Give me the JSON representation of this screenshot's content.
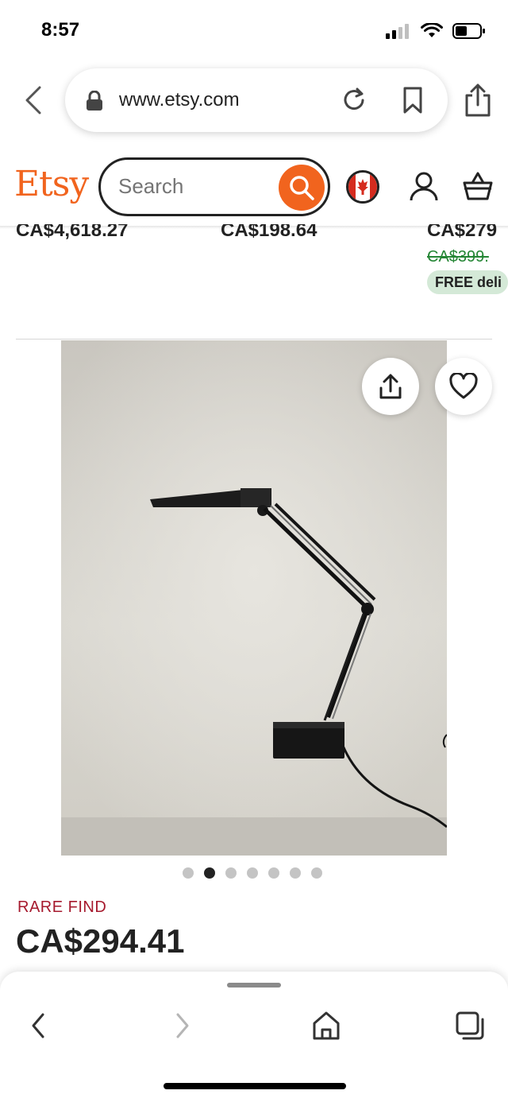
{
  "status_bar": {
    "time": "8:57",
    "icons": [
      "signal-icon",
      "wifi-icon",
      "battery-icon"
    ]
  },
  "browser": {
    "url": "www.etsy.com",
    "icons": [
      "back-arrow-icon",
      "lock-icon",
      "reload-icon",
      "bookmark-icon",
      "share-icon"
    ]
  },
  "header": {
    "logo": "Etsy",
    "search_placeholder": "Search",
    "icons": [
      "search-icon",
      "canada-flag-icon",
      "profile-icon",
      "cart-icon"
    ]
  },
  "prev_listings": {
    "prices": [
      "CA$4,618.27",
      "CA$198.64",
      "CA$279"
    ],
    "original_price": "CA$399.",
    "badge": "FREE deli"
  },
  "listing": {
    "image_subject": "black-articulated-desk-lamp",
    "image_count": 7,
    "active_image_index": 1,
    "label": "RARE FIND",
    "price": "CA$294.41"
  },
  "toolbar": {
    "icons": [
      "back-icon",
      "forward-icon",
      "home-icon",
      "tabs-icon"
    ]
  },
  "colors": {
    "brand": "#f1641e",
    "rare_find": "#a61a2e",
    "original_price": "#258635",
    "badge_bg": "#d4e9d7"
  }
}
